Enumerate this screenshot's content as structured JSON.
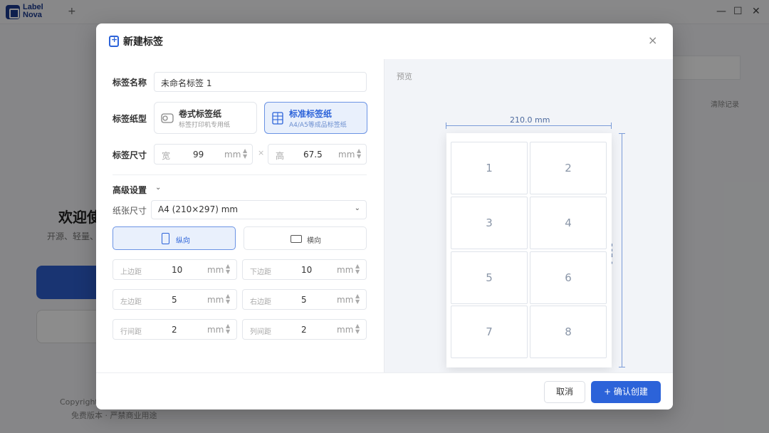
{
  "app": {
    "logo_text_1": "Label",
    "logo_text_2": "Nova",
    "new_tab": "+",
    "window_controls": [
      "—",
      "☐",
      "✕"
    ],
    "bg_clear_history": "清除记录",
    "bg_welcome": "欢迎使",
    "bg_sub": "开源、轻量、",
    "bg_copyright": "Copyright",
    "bg_rights": "免费版本 · 严禁商业用途"
  },
  "dialog": {
    "title": "新建标签",
    "close": "×",
    "name_label": "标签名称",
    "name_value": "未命名标签 1",
    "type_label": "标签纸型",
    "types": [
      {
        "title": "卷式标签纸",
        "desc": "标签打印机专用纸",
        "active": false
      },
      {
        "title": "标准标签纸",
        "desc": "A4/A5等成品标签纸",
        "active": true
      }
    ],
    "size_label": "标签尺寸",
    "width": {
      "prefix": "宽",
      "value": "99",
      "unit": "mm"
    },
    "height": {
      "prefix": "高",
      "value": "67.5",
      "unit": "mm"
    },
    "times": "×",
    "advanced": "高级设置",
    "paper_label": "纸张尺寸",
    "paper_value": "A4 (210×297) mm",
    "orientation": [
      {
        "label": "纵向",
        "active": true
      },
      {
        "label": "横向",
        "active": false
      }
    ],
    "margins": [
      {
        "label": "上边距",
        "value": "10",
        "unit": "mm"
      },
      {
        "label": "下边距",
        "value": "10",
        "unit": "mm"
      },
      {
        "label": "左边距",
        "value": "5",
        "unit": "mm"
      },
      {
        "label": "右边距",
        "value": "5",
        "unit": "mm"
      },
      {
        "label": "行间距",
        "value": "2",
        "unit": "mm"
      },
      {
        "label": "列间距",
        "value": "2",
        "unit": "mm"
      }
    ],
    "preview_label": "预览",
    "preview_width": "210.0 mm",
    "preview_height": "297.0 mm",
    "cells": [
      "1",
      "2",
      "3",
      "4",
      "5",
      "6",
      "7",
      "8"
    ],
    "cancel": "取消",
    "confirm": "+ 确认创建"
  },
  "colors": {
    "accent": "#2c63d9",
    "active_bg": "#e9f0fc"
  }
}
